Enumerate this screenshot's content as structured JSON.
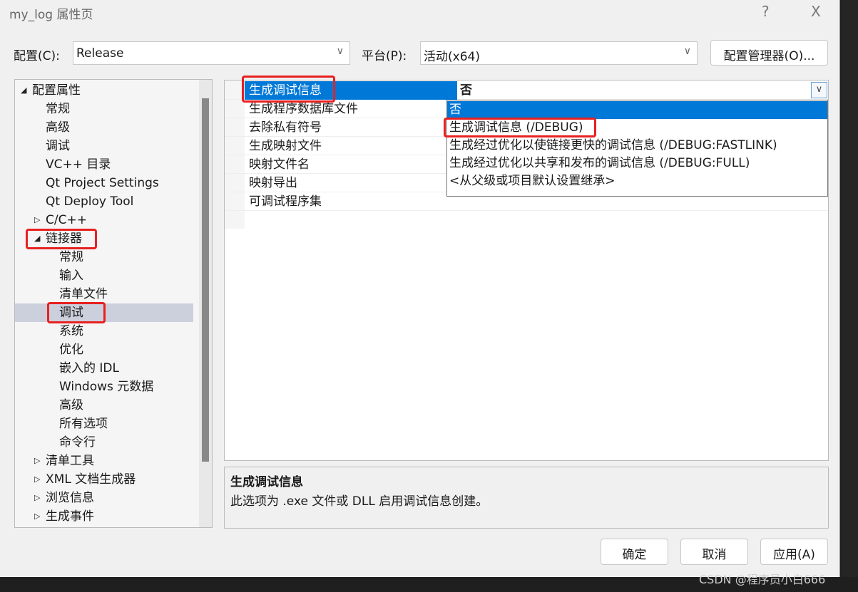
{
  "window": {
    "title": "my_log 属性页",
    "help": "?",
    "close": "X"
  },
  "config": {
    "label": "配置(C):",
    "value": "Release",
    "platform_label": "平台(P):",
    "platform_value": "活动(x64)",
    "manager_button": "配置管理器(O)..."
  },
  "tree": {
    "items": [
      {
        "label": "配置属性",
        "level": 0,
        "expander": "expanded"
      },
      {
        "label": "常规",
        "level": 1
      },
      {
        "label": "高级",
        "level": 1
      },
      {
        "label": "调试",
        "level": 1
      },
      {
        "label": "VC++ 目录",
        "level": 1
      },
      {
        "label": "Qt Project Settings",
        "level": 1
      },
      {
        "label": "Qt Deploy Tool",
        "level": 1
      },
      {
        "label": "C/C++",
        "level": 1,
        "expander": "collapsed"
      },
      {
        "label": "链接器",
        "level": 1,
        "expander": "expanded",
        "highlighted": true
      },
      {
        "label": "常规",
        "level": 2
      },
      {
        "label": "输入",
        "level": 2
      },
      {
        "label": "清单文件",
        "level": 2
      },
      {
        "label": "调试",
        "level": 2,
        "selected": true,
        "highlighted": true
      },
      {
        "label": "系统",
        "level": 2
      },
      {
        "label": "优化",
        "level": 2
      },
      {
        "label": "嵌入的 IDL",
        "level": 2
      },
      {
        "label": "Windows 元数据",
        "level": 2
      },
      {
        "label": "高级",
        "level": 2
      },
      {
        "label": "所有选项",
        "level": 2
      },
      {
        "label": "命令行",
        "level": 2
      },
      {
        "label": "清单工具",
        "level": 1,
        "expander": "collapsed"
      },
      {
        "label": "XML 文档生成器",
        "level": 1,
        "expander": "collapsed"
      },
      {
        "label": "浏览信息",
        "level": 1,
        "expander": "collapsed"
      },
      {
        "label": "生成事件",
        "level": 1,
        "expander": "collapsed"
      }
    ]
  },
  "grid": {
    "rows": [
      {
        "name": "生成调试信息",
        "value": "否",
        "selected": true
      },
      {
        "name": "生成程序数据库文件"
      },
      {
        "name": "去除私有符号"
      },
      {
        "name": "生成映射文件"
      },
      {
        "name": "映射文件名"
      },
      {
        "name": "映射导出"
      },
      {
        "name": "可调试程序集"
      }
    ]
  },
  "dropdown": {
    "options": [
      "否",
      "生成调试信息 (/DEBUG)",
      "生成经过优化以使链接更快的调试信息 (/DEBUG:FASTLINK)",
      "生成经过优化以共享和发布的调试信息 (/DEBUG:FULL)",
      "<从父级或项目默认设置继承>"
    ],
    "selected_index": 0,
    "highlighted_index": 1
  },
  "description": {
    "title": "生成调试信息",
    "text": "此选项为 .exe 文件或 DLL 启用调试信息创建。"
  },
  "buttons": {
    "ok": "确定",
    "cancel": "取消",
    "apply": "应用(A)"
  },
  "watermark": "CSDN @程序员小白666",
  "colors": {
    "selection": "#0078d7",
    "highlight_box": "#e82020",
    "tree_selected": "#ccd0dc"
  }
}
